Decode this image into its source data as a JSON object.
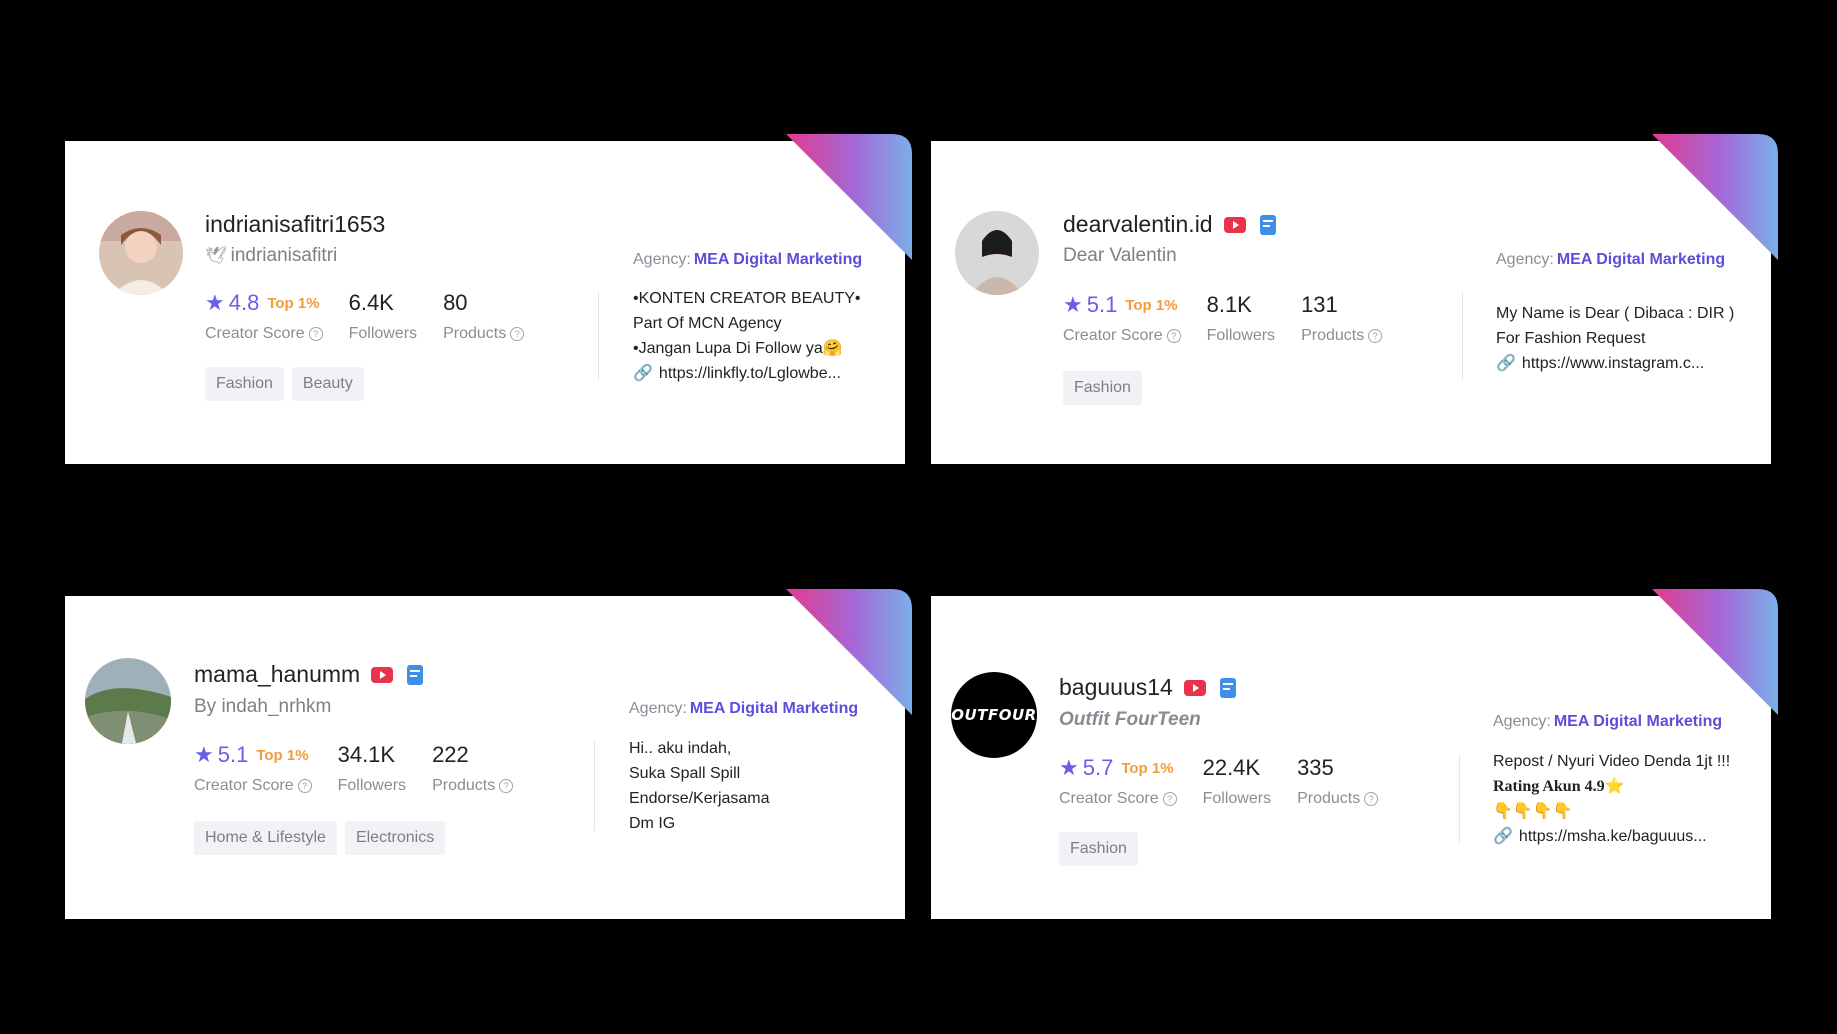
{
  "colors": {
    "accent": "#5b4fd9",
    "star": "#6a5fe8",
    "top": "#f29b3a",
    "corner_from": "#e23b8e",
    "corner_to": "#7ab0e8"
  },
  "cards": [
    {
      "handle": "indrianisafitri1653",
      "subtitle": "indrianisafitri",
      "subtitle_icon": "dove-icon",
      "score": "4.8",
      "top": "Top 1%",
      "score_label": "Creator Score",
      "followers": "6.4K",
      "followers_label": "Followers",
      "products": "80",
      "products_label": "Products",
      "tags": [
        "Fashion",
        "Beauty"
      ],
      "agency_label": "Agency:",
      "agency": "MEA Digital Marketing",
      "bio": [
        "•KONTEN  CREATOR BEAUTY•",
        "Part Of MCN Agency",
        "•Jangan Lupa Di Follow ya🤗"
      ],
      "link": "https://linkfly.to/Lglowbe..."
    },
    {
      "handle": "dearvalentin.id",
      "subtitle": "Dear Valentin",
      "score": "5.1",
      "top": "Top 1%",
      "score_label": "Creator Score",
      "followers": "8.1K",
      "followers_label": "Followers",
      "products": "131",
      "products_label": "Products",
      "tags": [
        "Fashion"
      ],
      "agency_label": "Agency:",
      "agency": "MEA Digital Marketing",
      "bio": [
        "My Name is Dear ( Dibaca : DIR )",
        "For Fashion Request"
      ],
      "link": "https://www.instagram.c..."
    },
    {
      "handle": "mama_hanumm",
      "subtitle": "By indah_nrhkm",
      "score": "5.1",
      "top": "Top 1%",
      "score_label": "Creator Score",
      "followers": "34.1K",
      "followers_label": "Followers",
      "products": "222",
      "products_label": "Products",
      "tags": [
        "Home & Lifestyle",
        "Electronics"
      ],
      "agency_label": "Agency:",
      "agency": "MEA Digital Marketing",
      "bio": [
        "Hi.. aku indah,",
        "Suka Spall Spill",
        "Endorse/Kerjasama",
        "Dm IG"
      ],
      "link": ""
    },
    {
      "handle": "baguuus14",
      "subtitle": "Outfit FourTeen",
      "avatar_text": "OUTFOUR",
      "score": "5.7",
      "top": "Top 1%",
      "score_label": "Creator Score",
      "followers": "22.4K",
      "followers_label": "Followers",
      "products": "335",
      "products_label": "Products",
      "tags": [
        "Fashion"
      ],
      "agency_label": "Agency:",
      "agency": "MEA Digital Marketing",
      "bio": [
        "Repost / Nyuri Video Denda 1jt !!!",
        "Rating Akun 4.9⭐",
        "👇👇👇👇"
      ],
      "link": "https://msha.ke/baguuus..."
    }
  ]
}
